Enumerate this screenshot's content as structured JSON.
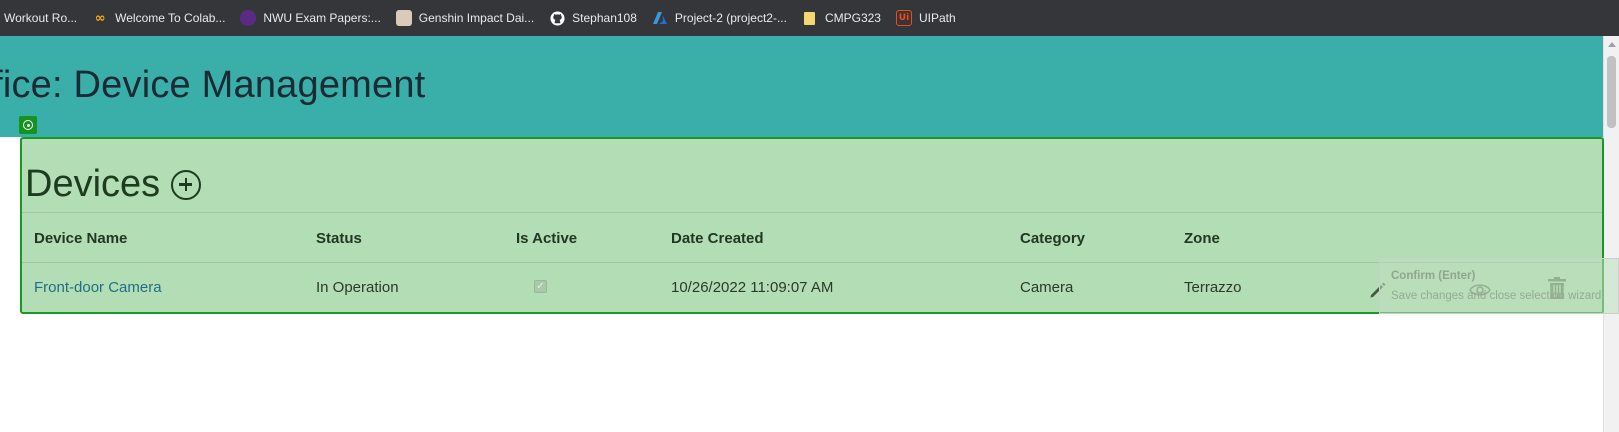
{
  "bookmarks": [
    {
      "label": "Workout Ro...",
      "icon": "none"
    },
    {
      "label": "Welcome To Colab...",
      "icon": "colab-icon"
    },
    {
      "label": "NWU Exam Papers:...",
      "icon": "nwu-icon"
    },
    {
      "label": "Genshin Impact Dai...",
      "icon": "genshin-icon"
    },
    {
      "label": "Stephan108",
      "icon": "github-icon"
    },
    {
      "label": "Project-2 (project2-...",
      "icon": "azure-icon"
    },
    {
      "label": "CMPG323",
      "icon": "folder-icon"
    },
    {
      "label": "UIPath",
      "icon": "uipath-icon"
    }
  ],
  "header": {
    "title": "ffice: Device Management"
  },
  "devices": {
    "title": "Devices",
    "columns": [
      "Device Name",
      "Status",
      "Is Active",
      "Date Created",
      "Category",
      "Zone"
    ],
    "rows": [
      {
        "name": "Front-door Camera",
        "status": "In Operation",
        "is_active": true,
        "date_created": "10/26/2022 11:09:07 AM",
        "category": "Camera",
        "zone": "Terrazzo"
      }
    ]
  },
  "tooltip": {
    "title": "Confirm (Enter)",
    "text": "Save changes and close selection wizard."
  },
  "colors": {
    "header_bg": "#3aafa9",
    "selection_fill": "#b3ddb4",
    "selection_border": "#1a9a22",
    "link": "#1f6f86"
  }
}
